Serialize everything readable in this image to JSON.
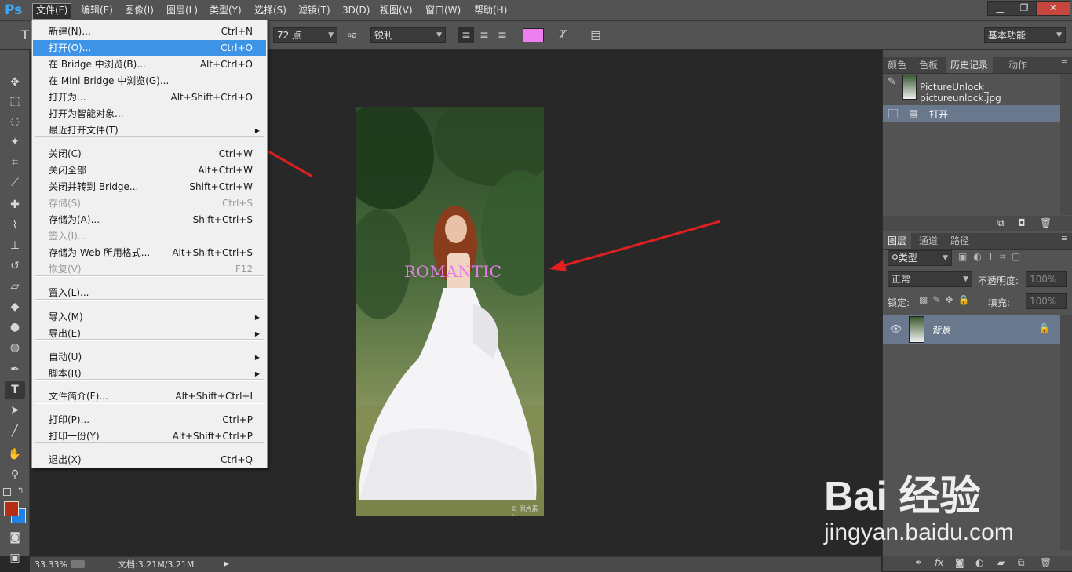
{
  "app": {
    "logo": "Ps"
  },
  "menubar": {
    "items": [
      "文件(F)",
      "编辑(E)",
      "图像(I)",
      "图层(L)",
      "类型(Y)",
      "选择(S)",
      "滤镜(T)",
      "3D(D)",
      "视图(V)",
      "窗口(W)",
      "帮助(H)"
    ],
    "window_buttons": [
      "minimize",
      "restore",
      "close"
    ]
  },
  "options": {
    "tool_icon": "T",
    "font_size": "72 点",
    "antialias_icon_label": "a",
    "antialias": "锐利",
    "text_color": "#ee7fee",
    "workspace": "基本功能"
  },
  "file_menu": {
    "items": [
      {
        "label": "新建(N)...",
        "shortcut": "Ctrl+N"
      },
      {
        "label": "打开(O)...",
        "shortcut": "Ctrl+O",
        "highlighted": true
      },
      {
        "label": "在 Bridge 中浏览(B)...",
        "shortcut": "Alt+Ctrl+O"
      },
      {
        "label": "在 Mini Bridge 中浏览(G)...",
        "shortcut": ""
      },
      {
        "label": "打开为...",
        "shortcut": "Alt+Shift+Ctrl+O"
      },
      {
        "label": "打开为智能对象...",
        "shortcut": ""
      },
      {
        "label": "最近打开文件(T)",
        "shortcut": "",
        "submenu": true
      },
      {
        "label": "关闭(C)",
        "shortcut": "Ctrl+W"
      },
      {
        "label": "关闭全部",
        "shortcut": "Alt+Ctrl+W"
      },
      {
        "label": "关闭并转到 Bridge...",
        "shortcut": "Shift+Ctrl+W"
      },
      {
        "label": "存储(S)",
        "shortcut": "Ctrl+S",
        "disabled": true
      },
      {
        "label": "存储为(A)...",
        "shortcut": "Shift+Ctrl+S"
      },
      {
        "label": "签入(I)...",
        "shortcut": "",
        "disabled": true
      },
      {
        "label": "存储为 Web 所用格式...",
        "shortcut": "Alt+Shift+Ctrl+S"
      },
      {
        "label": "恢复(V)",
        "shortcut": "F12",
        "disabled": true
      },
      {
        "label": "置入(L)...",
        "shortcut": ""
      },
      {
        "label": "导入(M)",
        "shortcut": "",
        "submenu": true
      },
      {
        "label": "导出(E)",
        "shortcut": "",
        "submenu": true
      },
      {
        "label": "自动(U)",
        "shortcut": "",
        "submenu": true
      },
      {
        "label": "脚本(R)",
        "shortcut": "",
        "submenu": true
      },
      {
        "label": "文件简介(F)...",
        "shortcut": "Alt+Shift+Ctrl+I"
      },
      {
        "label": "打印(P)...",
        "shortcut": "Ctrl+P"
      },
      {
        "label": "打印一份(Y)",
        "shortcut": "Alt+Shift+Ctrl+P"
      },
      {
        "label": "退出(X)",
        "shortcut": "Ctrl+Q"
      }
    ]
  },
  "canvas": {
    "overlay_text": "ROMANTIC",
    "overlay_color": "#e27fe6",
    "photo_caption": "© 照片素材"
  },
  "status": {
    "zoom": "33.33%",
    "doc": "文档:3.21M/3.21M"
  },
  "panels": {
    "top_tabs": [
      "颜色",
      "色板",
      "历史记录",
      "动作"
    ],
    "history": {
      "snapshot": "PictureUnlock_ pictureunlock.jpg",
      "step": "打开"
    },
    "layer_tabs": [
      "图层",
      "通道",
      "路径"
    ],
    "filter_kind": "类型",
    "blend_mode": "正常",
    "opacity_label": "不透明度:",
    "opacity_value": "100%",
    "lock_label": "锁定:",
    "fill_label": "填充:",
    "fill_value": "100%",
    "layer_name": "背景"
  },
  "watermark": {
    "brand": "Bai 经验",
    "url": "jingyan.baidu.com"
  }
}
